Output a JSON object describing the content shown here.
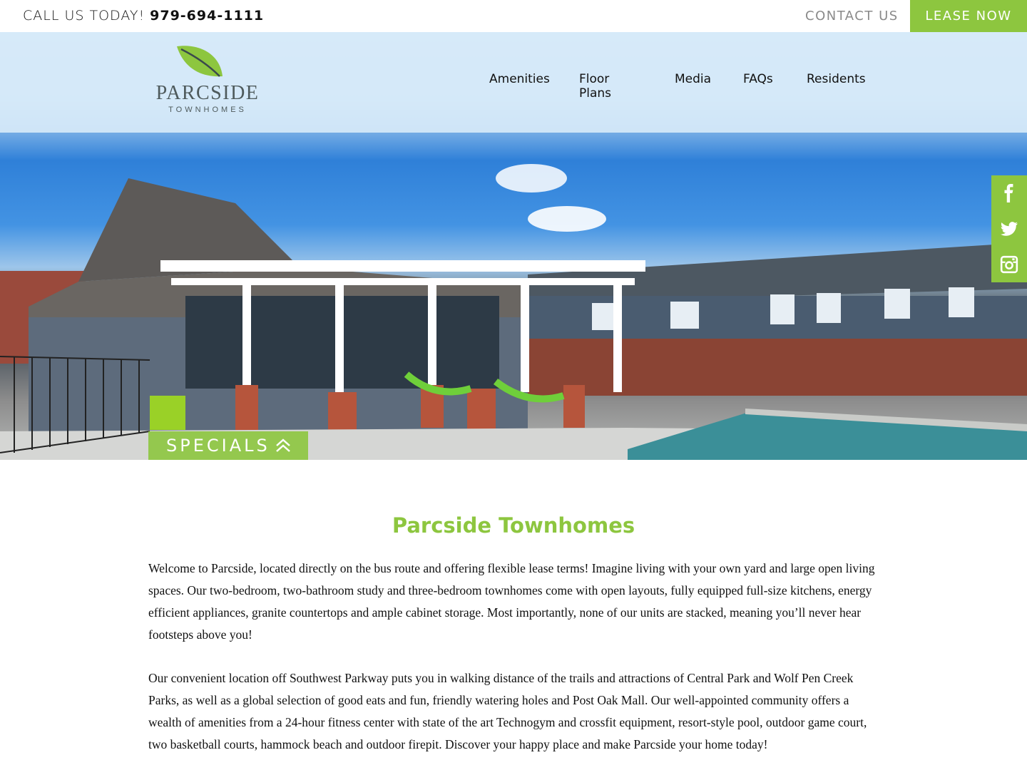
{
  "topbar": {
    "call_label": "CALL US TODAY!",
    "phone": "979-694-1111",
    "contact_label": "CONTACT US",
    "lease_label": "LEASE NOW"
  },
  "logo": {
    "name": "PARCSIDE",
    "sub": "TOWNHOMES"
  },
  "nav": [
    "Amenities",
    "Floor Plans",
    "Media",
    "FAQs",
    "Residents"
  ],
  "social": [
    "facebook-icon",
    "twitter-icon",
    "instagram-icon"
  ],
  "specials_label": "SPECIALS",
  "content": {
    "title": "Parcside Townhomes",
    "p1": "Welcome to Parcside, located directly on the bus route and offering flexible lease terms! Imagine living with your own yard and large open living spaces. Our two-bedroom, two-bathroom study and three-bedroom townhomes come with open layouts, fully equipped full-size kitchens, energy efficient appliances, granite countertops and ample cabinet storage. Most importantly, none of our units are stacked, meaning you’ll never hear footsteps above you!",
    "p2": "Our convenient location off Southwest Parkway puts you in walking distance of the trails and attractions of Central Park and Wolf Pen Creek Parks, as well as a global selection of good eats and fun, friendly watering holes and Post Oak Mall. Our well-appointed community offers a wealth of amenities from a 24-hour fitness center with state of the art Technogym and crossfit equipment, resort-style pool, outdoor game court, two basketball courts, hammock beach and outdoor firepit. Discover your happy place and make Parcside your home today!"
  },
  "colors": {
    "brand_green": "#8dc63f",
    "header_bg": "#d6e9f8",
    "muted_text": "#8a8a8a"
  }
}
